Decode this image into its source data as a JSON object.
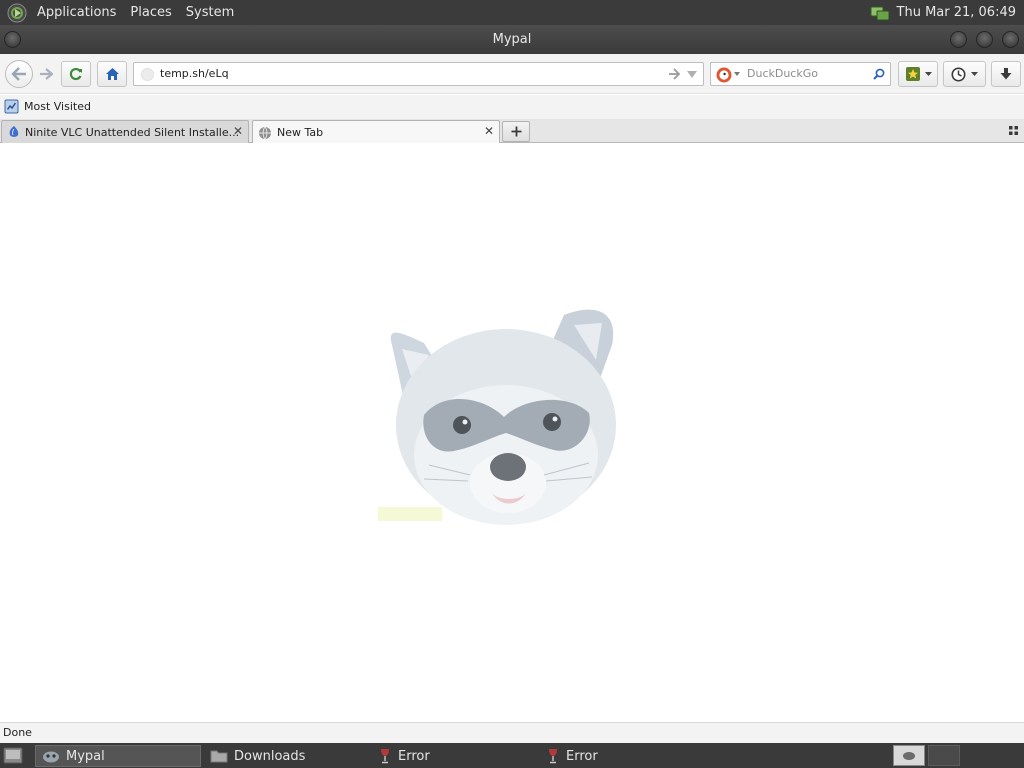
{
  "top_panel": {
    "menus": [
      "Applications",
      "Places",
      "System"
    ],
    "clock": "Thu Mar 21, 06:49"
  },
  "window": {
    "title": "Mypal"
  },
  "navbar": {
    "url": "temp.sh/eLq",
    "search_placeholder": "DuckDuckGo"
  },
  "bookmarks": {
    "most_visited": "Most Visited"
  },
  "tabs": [
    {
      "label": "Ninite VLC Unattended Silent Installe...",
      "active": false
    },
    {
      "label": "New Tab",
      "active": true
    }
  ],
  "status": "Done",
  "taskbar": [
    {
      "label": "Mypal",
      "active": true
    },
    {
      "label": "Downloads"
    },
    {
      "label": "Error"
    },
    {
      "label": "Error"
    }
  ],
  "colors": {
    "panel": "#3b3b3b",
    "toolbar": "#f3f3f3",
    "accent_blue": "#2a62b8"
  }
}
